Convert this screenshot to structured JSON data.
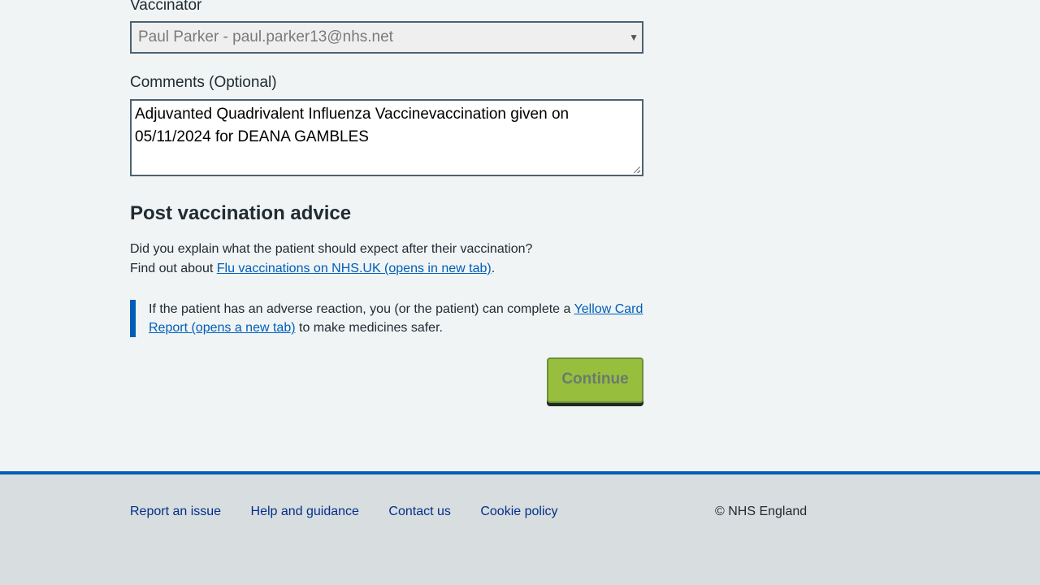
{
  "form": {
    "vaccinator_label": "Vaccinator",
    "vaccinator_value": "Paul Parker - paul.parker13@nhs.net",
    "comments_label": "Comments (Optional)",
    "comments_value": "Adjuvanted Quadrivalent Influenza Vaccinevaccination given on 05/11/2024 for DEANA GAMBLES"
  },
  "advice": {
    "heading": "Post vaccination advice",
    "question": "Did you explain what the patient should expect after their vaccination?",
    "find_out_prefix": "Find out about ",
    "flu_link": "Flu vaccinations on NHS.UK (opens in new tab)",
    "find_out_suffix": ".",
    "inset_prefix": "If the patient has an adverse reaction, you (or the patient) can complete a ",
    "yellow_card_link": "Yellow Card Report (opens a new tab)",
    "inset_suffix": " to make medicines safer."
  },
  "actions": {
    "continue_label": "Continue"
  },
  "footer": {
    "links": [
      "Report an issue",
      "Help and guidance",
      "Contact us",
      "Cookie policy"
    ],
    "copyright": "© NHS England"
  }
}
